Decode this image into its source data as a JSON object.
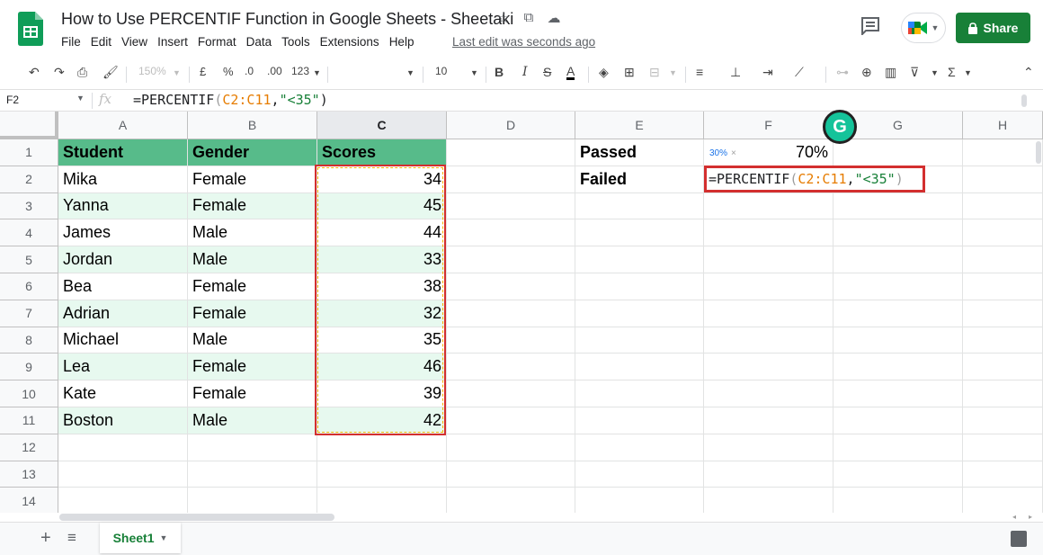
{
  "header": {
    "title": "How to Use PERCENTIF Function in Google Sheets - Sheetaki",
    "menu": [
      "File",
      "Edit",
      "View",
      "Insert",
      "Format",
      "Data",
      "Tools",
      "Extensions",
      "Help"
    ],
    "last_edit": "Last edit was seconds ago",
    "share_label": "Share",
    "icons": [
      "star-icon",
      "move-folder-icon",
      "cloud-status-icon",
      "comment-icon",
      "meet-icon",
      "lock-icon"
    ]
  },
  "toolbar": {
    "zoom": "150%",
    "currency": "£",
    "percent": "%",
    "decrease_decimal": ".0",
    "increase_decimal": ".00",
    "more_formats": "123",
    "font_size": "10",
    "bold": "B",
    "italic": "I",
    "strikethrough": "S",
    "text_color": "A"
  },
  "formula_bar": {
    "name_box": "F2",
    "fx": "fx",
    "formula_fn": "=PERCENTIF",
    "formula_ref": "C2:C11",
    "formula_crit": "\"<35\""
  },
  "columns": [
    "A",
    "B",
    "C",
    "D",
    "E",
    "F",
    "G",
    "H"
  ],
  "rows": [
    "1",
    "2",
    "3",
    "4",
    "5",
    "6",
    "7",
    "8",
    "9",
    "10",
    "11",
    "12",
    "13",
    "14"
  ],
  "table": {
    "headers": [
      "Student",
      "Gender",
      "Scores"
    ],
    "records": [
      {
        "student": "Mika",
        "gender": "Female",
        "score": "34"
      },
      {
        "student": "Yanna",
        "gender": "Female",
        "score": "45"
      },
      {
        "student": "James",
        "gender": "Male",
        "score": "44"
      },
      {
        "student": "Jordan",
        "gender": "Male",
        "score": "33"
      },
      {
        "student": "Bea",
        "gender": "Female",
        "score": "38"
      },
      {
        "student": "Adrian",
        "gender": "Female",
        "score": "32"
      },
      {
        "student": "Michael",
        "gender": "Male",
        "score": "35"
      },
      {
        "student": "Lea",
        "gender": "Female",
        "score": "46"
      },
      {
        "student": "Kate",
        "gender": "Female",
        "score": "39"
      },
      {
        "student": "Boston",
        "gender": "Male",
        "score": "42"
      }
    ]
  },
  "summary": {
    "passed_label": "Passed",
    "passed_value": "70%",
    "failed_label": "Failed",
    "preview_chip": "30%",
    "chip_close": "×"
  },
  "grammarly": "G",
  "sheets": {
    "active": "Sheet1"
  },
  "colors": {
    "header_green": "#57bb8a",
    "band_green": "#e7f9ef",
    "share_green": "#188038",
    "highlight_red": "#d32f2f",
    "ref_orange": "#e67c00"
  }
}
